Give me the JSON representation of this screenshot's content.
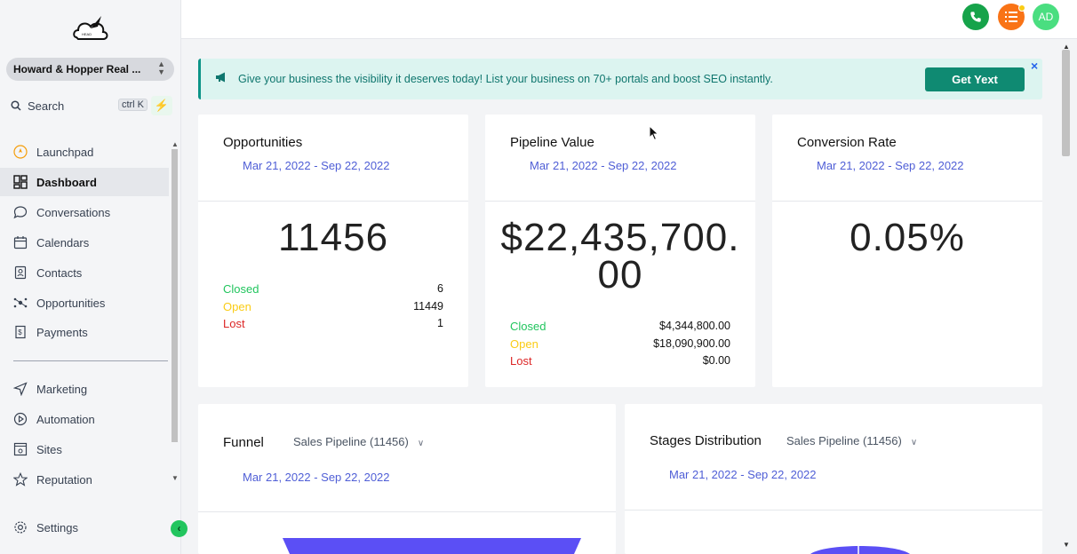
{
  "sidebar": {
    "account_name": "Howard & Hopper Real ...",
    "search_label": "Search",
    "search_shortcut": "ctrl K",
    "items": [
      {
        "label": "Launchpad",
        "icon": "rocket-icon"
      },
      {
        "label": "Dashboard",
        "icon": "dashboard-icon"
      },
      {
        "label": "Conversations",
        "icon": "chat-icon"
      },
      {
        "label": "Calendars",
        "icon": "calendar-icon"
      },
      {
        "label": "Contacts",
        "icon": "contacts-icon"
      },
      {
        "label": "Opportunities",
        "icon": "opportunities-icon"
      },
      {
        "label": "Payments",
        "icon": "payments-icon"
      },
      {
        "label": "Marketing",
        "icon": "send-icon"
      },
      {
        "label": "Automation",
        "icon": "automation-icon"
      },
      {
        "label": "Sites",
        "icon": "sites-icon"
      },
      {
        "label": "Reputation",
        "icon": "star-icon"
      },
      {
        "label": "Settings",
        "icon": "gear-icon"
      }
    ],
    "active_item": "Dashboard"
  },
  "topbar": {
    "avatar_initials": "AD"
  },
  "banner": {
    "text": "Give your business the visibility it deserves today! List your business on 70+ portals and boost SEO instantly.",
    "cta_label": "Get Yext",
    "close": "×"
  },
  "cards": {
    "opportunities": {
      "title": "Opportunities",
      "date_range": "Mar 21, 2022 - Sep 22, 2022",
      "total": "11456",
      "stats": [
        {
          "label": "Closed",
          "value": "6"
        },
        {
          "label": "Open",
          "value": "11449"
        },
        {
          "label": "Lost",
          "value": "1"
        }
      ]
    },
    "pipeline": {
      "title": "Pipeline Value",
      "date_range": "Mar 21, 2022 - Sep 22, 2022",
      "total_line1": "$22,435,700.",
      "total_line2": "00",
      "stats": [
        {
          "label": "Closed",
          "value": "$4,344,800.00"
        },
        {
          "label": "Open",
          "value": "$18,090,900.00"
        },
        {
          "label": "Lost",
          "value": "$0.00"
        }
      ]
    },
    "conversion": {
      "title": "Conversion Rate",
      "date_range": "Mar 21, 2022 - Sep 22, 2022",
      "value": "0.05%"
    },
    "funnel": {
      "title": "Funnel",
      "pipeline": "Sales Pipeline (11456)",
      "date_range": "Mar 21, 2022 - Sep 22, 2022"
    },
    "stages": {
      "title": "Stages Distribution",
      "pipeline": "Sales Pipeline (11456)",
      "date_range": "Mar 21, 2022 - Sep 22, 2022"
    }
  },
  "colors": {
    "accent": "#4f5ed6",
    "closed": "#22c55e",
    "open": "#facc15",
    "lost": "#dc2626",
    "banner_bg": "#dcf4f0",
    "cta": "#0f8a72",
    "funnel": "#5b4ff5"
  }
}
